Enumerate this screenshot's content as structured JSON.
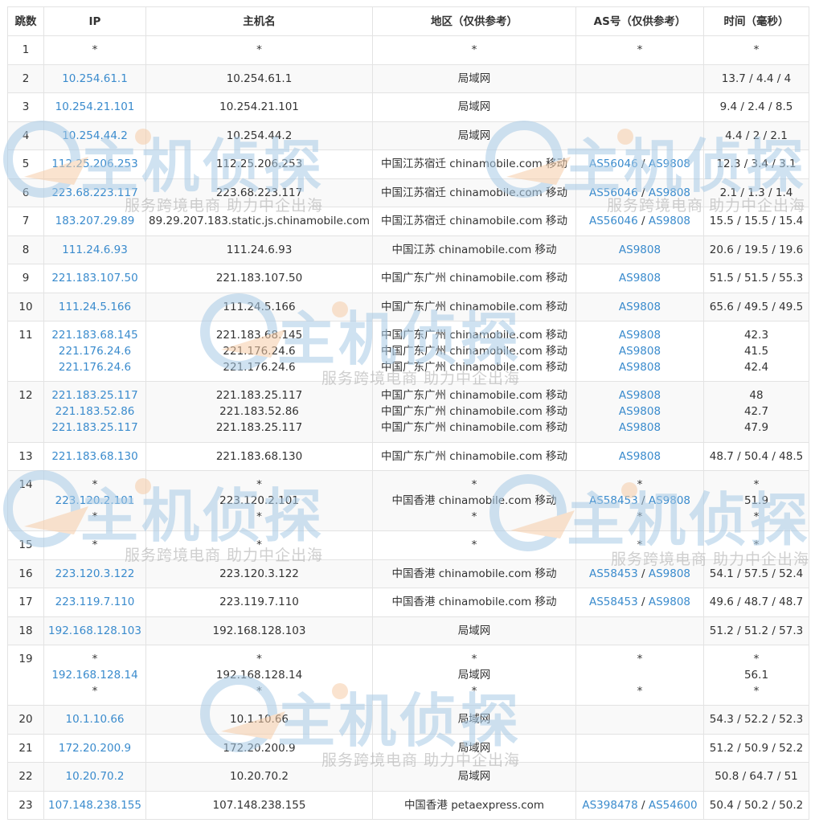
{
  "table": {
    "headers": [
      "跳数",
      "IP",
      "主机名",
      "地区（仅供参考）",
      "AS号（仅供参考）",
      "时间（毫秒）"
    ],
    "rows": [
      {
        "hop": "1",
        "ip": [
          "*"
        ],
        "host": [
          "*"
        ],
        "region": [
          "*"
        ],
        "as": [
          [
            "*"
          ]
        ],
        "time": [
          "*"
        ]
      },
      {
        "hop": "2",
        "ip": [
          "10.254.61.1"
        ],
        "host": [
          "10.254.61.1"
        ],
        "region": [
          "局域网"
        ],
        "as": [],
        "time": [
          "13.7 / 4.4 / 4"
        ]
      },
      {
        "hop": "3",
        "ip": [
          "10.254.21.101"
        ],
        "host": [
          "10.254.21.101"
        ],
        "region": [
          "局域网"
        ],
        "as": [],
        "time": [
          "9.4 / 2.4 / 8.5"
        ]
      },
      {
        "hop": "4",
        "ip": [
          "10.254.44.2"
        ],
        "host": [
          "10.254.44.2"
        ],
        "region": [
          "局域网"
        ],
        "as": [],
        "time": [
          "4.4 / 2 / 2.1"
        ]
      },
      {
        "hop": "5",
        "ip": [
          "112.25.206.253"
        ],
        "host": [
          "112.25.206.253"
        ],
        "region": [
          "中国江苏宿迁 chinamobile.com 移动"
        ],
        "as": [
          [
            "AS56046",
            "AS9808"
          ]
        ],
        "time": [
          "12.3 / 3.4 / 3.1"
        ]
      },
      {
        "hop": "6",
        "ip": [
          "223.68.223.117"
        ],
        "host": [
          "223.68.223.117"
        ],
        "region": [
          "中国江苏宿迁 chinamobile.com 移动"
        ],
        "as": [
          [
            "AS56046",
            "AS9808"
          ]
        ],
        "time": [
          "2.1 / 1.3 / 1.4"
        ]
      },
      {
        "hop": "7",
        "ip": [
          "183.207.29.89"
        ],
        "host": [
          "89.29.207.183.static.js.chinamobile.com"
        ],
        "region": [
          "中国江苏宿迁 chinamobile.com 移动"
        ],
        "as": [
          [
            "AS56046",
            "AS9808"
          ]
        ],
        "time": [
          "15.5 / 15.5 / 15.4"
        ]
      },
      {
        "hop": "8",
        "ip": [
          "111.24.6.93"
        ],
        "host": [
          "111.24.6.93"
        ],
        "region": [
          "中国江苏 chinamobile.com 移动"
        ],
        "as": [
          [
            "AS9808"
          ]
        ],
        "time": [
          "20.6 / 19.5 / 19.6"
        ]
      },
      {
        "hop": "9",
        "ip": [
          "221.183.107.50"
        ],
        "host": [
          "221.183.107.50"
        ],
        "region": [
          "中国广东广州 chinamobile.com 移动"
        ],
        "as": [
          [
            "AS9808"
          ]
        ],
        "time": [
          "51.5 / 51.5 / 55.3"
        ]
      },
      {
        "hop": "10",
        "ip": [
          "111.24.5.166"
        ],
        "host": [
          "111.24.5.166"
        ],
        "region": [
          "中国广东广州 chinamobile.com 移动"
        ],
        "as": [
          [
            "AS9808"
          ]
        ],
        "time": [
          "65.6 / 49.5 / 49.5"
        ]
      },
      {
        "hop": "11",
        "ip": [
          "221.183.68.145",
          "221.176.24.6",
          "221.176.24.6"
        ],
        "host": [
          "221.183.68.145",
          "221.176.24.6",
          "221.176.24.6"
        ],
        "region": [
          "中国广东广州 chinamobile.com 移动",
          "中国广东广州 chinamobile.com 移动",
          "中国广东广州 chinamobile.com 移动"
        ],
        "as": [
          [
            "AS9808"
          ],
          [
            "AS9808"
          ],
          [
            "AS9808"
          ]
        ],
        "time": [
          "42.3",
          "41.5",
          "42.4"
        ]
      },
      {
        "hop": "12",
        "ip": [
          "221.183.25.117",
          "221.183.52.86",
          "221.183.25.117"
        ],
        "host": [
          "221.183.25.117",
          "221.183.52.86",
          "221.183.25.117"
        ],
        "region": [
          "中国广东广州 chinamobile.com 移动",
          "中国广东广州 chinamobile.com 移动",
          "中国广东广州 chinamobile.com 移动"
        ],
        "as": [
          [
            "AS9808"
          ],
          [
            "AS9808"
          ],
          [
            "AS9808"
          ]
        ],
        "time": [
          "48",
          "42.7",
          "47.9"
        ]
      },
      {
        "hop": "13",
        "ip": [
          "221.183.68.130"
        ],
        "host": [
          "221.183.68.130"
        ],
        "region": [
          "中国广东广州 chinamobile.com 移动"
        ],
        "as": [
          [
            "AS9808"
          ]
        ],
        "time": [
          "48.7 / 50.4 / 48.5"
        ]
      },
      {
        "hop": "14",
        "ip": [
          "*",
          "223.120.2.101",
          "*"
        ],
        "host": [
          "*",
          "223.120.2.101",
          "*"
        ],
        "region": [
          "*",
          "中国香港 chinamobile.com 移动",
          "*"
        ],
        "as": [
          [
            "*"
          ],
          [
            "AS58453",
            "AS9808"
          ],
          [
            "*"
          ]
        ],
        "time": [
          "*",
          "51.9",
          "*"
        ]
      },
      {
        "hop": "15",
        "ip": [
          "*"
        ],
        "host": [
          "*"
        ],
        "region": [
          "*"
        ],
        "as": [
          [
            "*"
          ]
        ],
        "time": [
          "*"
        ]
      },
      {
        "hop": "16",
        "ip": [
          "223.120.3.122"
        ],
        "host": [
          "223.120.3.122"
        ],
        "region": [
          "中国香港 chinamobile.com 移动"
        ],
        "as": [
          [
            "AS58453",
            "AS9808"
          ]
        ],
        "time": [
          "54.1 / 57.5 / 52.4"
        ]
      },
      {
        "hop": "17",
        "ip": [
          "223.119.7.110"
        ],
        "host": [
          "223.119.7.110"
        ],
        "region": [
          "中国香港 chinamobile.com 移动"
        ],
        "as": [
          [
            "AS58453",
            "AS9808"
          ]
        ],
        "time": [
          "49.6 / 48.7 / 48.7"
        ]
      },
      {
        "hop": "18",
        "ip": [
          "192.168.128.103"
        ],
        "host": [
          "192.168.128.103"
        ],
        "region": [
          "局域网"
        ],
        "as": [],
        "time": [
          "51.2 / 51.2 / 57.3"
        ]
      },
      {
        "hop": "19",
        "ip": [
          "*",
          "192.168.128.14",
          "*"
        ],
        "host": [
          "*",
          "192.168.128.14",
          "*"
        ],
        "region": [
          "*",
          "局域网",
          "*"
        ],
        "as": [
          [
            "*"
          ],
          [
            ""
          ],
          [
            "*"
          ]
        ],
        "time": [
          "*",
          "56.1",
          "*"
        ]
      },
      {
        "hop": "20",
        "ip": [
          "10.1.10.66"
        ],
        "host": [
          "10.1.10.66"
        ],
        "region": [
          "局域网"
        ],
        "as": [],
        "time": [
          "54.3 / 52.2 / 52.3"
        ]
      },
      {
        "hop": "21",
        "ip": [
          "172.20.200.9"
        ],
        "host": [
          "172.20.200.9"
        ],
        "region": [
          "局域网"
        ],
        "as": [],
        "time": [
          "51.2 / 50.9 / 52.2"
        ]
      },
      {
        "hop": "22",
        "ip": [
          "10.20.70.2"
        ],
        "host": [
          "10.20.70.2"
        ],
        "region": [
          "局域网"
        ],
        "as": [],
        "time": [
          "50.8 / 64.7 / 51"
        ]
      },
      {
        "hop": "23",
        "ip": [
          "107.148.238.155"
        ],
        "host": [
          "107.148.238.155"
        ],
        "region": [
          "中国香港 petaexpress.com"
        ],
        "as": [
          [
            "AS398478",
            "AS54600"
          ]
        ],
        "time": [
          "50.4 / 50.2 / 50.2"
        ]
      }
    ]
  },
  "watermark": {
    "title": "主机侦探",
    "slogan": "服务跨境电商 助力中企出海"
  },
  "colors": {
    "link": "#3a8bcd",
    "border": "#e3e3e3",
    "stripe": "#f9f9f9",
    "watermark_blue": "#a9cbe6",
    "watermark_orange": "#f6cda8"
  }
}
